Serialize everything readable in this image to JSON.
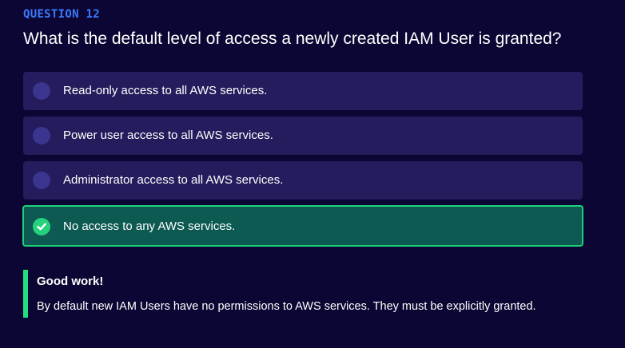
{
  "question": {
    "number_label": "QUESTION 12",
    "text": "What is the default level of access a newly created IAM User is granted?"
  },
  "options": [
    {
      "label": "Read-only access to all AWS services.",
      "state": "unselected"
    },
    {
      "label": "Power user access to all AWS services.",
      "state": "unselected"
    },
    {
      "label": "Administrator access to all AWS services.",
      "state": "unselected"
    },
    {
      "label": "No access to any AWS services.",
      "state": "correct"
    }
  ],
  "feedback": {
    "title": "Good work!",
    "body": "By default new IAM Users have no permissions to AWS services. They must be explicitly granted."
  },
  "colors": {
    "background": "#0b0633",
    "question_number": "#3d7bff",
    "option_bg": "#241c5c",
    "radio": "#3b3590",
    "correct_bg": "#0c5a52",
    "correct_border": "#1fd07a",
    "feedback_bar": "#1fe07e"
  },
  "icons": {
    "correct": "check-circle-icon",
    "unselected": "radio-empty-icon"
  }
}
